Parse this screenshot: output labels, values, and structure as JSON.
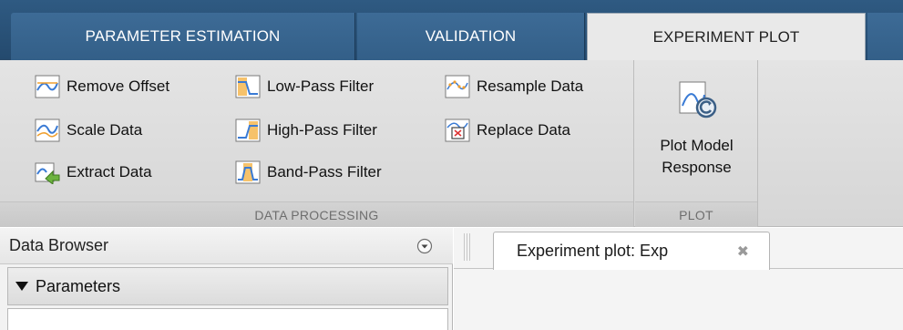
{
  "tabs": {
    "parameter_estimation": "PARAMETER ESTIMATION",
    "validation": "VALIDATION",
    "experiment_plot": "EXPERIMENT PLOT"
  },
  "ribbon": {
    "data_processing": {
      "label": "DATA PROCESSING",
      "buttons": {
        "remove_offset": "Remove Offset",
        "scale_data": "Scale Data",
        "extract_data": "Extract Data",
        "low_pass": "Low-Pass Filter",
        "high_pass": "High-Pass Filter",
        "band_pass": "Band-Pass Filter",
        "resample": "Resample Data",
        "replace": "Replace Data"
      }
    },
    "plot": {
      "label": "PLOT",
      "plot_model_response_line1": "Plot Model",
      "plot_model_response_line2": "Response"
    }
  },
  "data_browser": {
    "title": "Data Browser",
    "parameters_label": "Parameters"
  },
  "document": {
    "tab_title": "Experiment plot: Exp",
    "close_glyph": "✖"
  },
  "colors": {
    "tabstrip": "#2f5a82",
    "ribbon": "#e4e4e4",
    "signal_blue": "#3a7bd5",
    "filter_orange": "#f0a030"
  }
}
